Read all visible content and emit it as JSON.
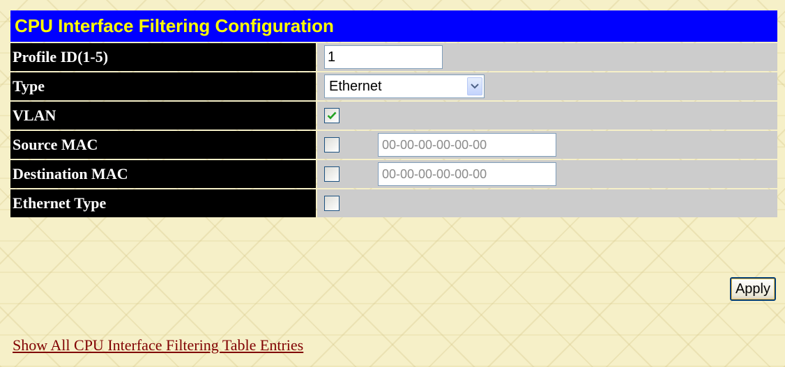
{
  "title": "CPU Interface Filtering Configuration",
  "colors": {
    "title_bg": "#0000ff",
    "title_text": "#ffff00",
    "label_bg": "#000000",
    "label_text": "#ffffff",
    "value_bg": "#cccccc",
    "page_bg": "#f6f0c8",
    "link": "#800000"
  },
  "fields": {
    "profile_id": {
      "label": "Profile ID(1-5)",
      "value": "1"
    },
    "type": {
      "label": "Type",
      "selected": "Ethernet",
      "icon": "chevron-down-icon"
    },
    "vlan": {
      "label": "VLAN",
      "checked": true
    },
    "source_mac": {
      "label": "Source MAC",
      "checked": false,
      "placeholder": "00-00-00-00-00-00"
    },
    "destination_mac": {
      "label": "Destination MAC",
      "checked": false,
      "placeholder": "00-00-00-00-00-00"
    },
    "ethernet_type": {
      "label": "Ethernet Type",
      "checked": false
    }
  },
  "buttons": {
    "apply": "Apply"
  },
  "links": {
    "show_all": "Show All CPU Interface Filtering Table Entries"
  }
}
